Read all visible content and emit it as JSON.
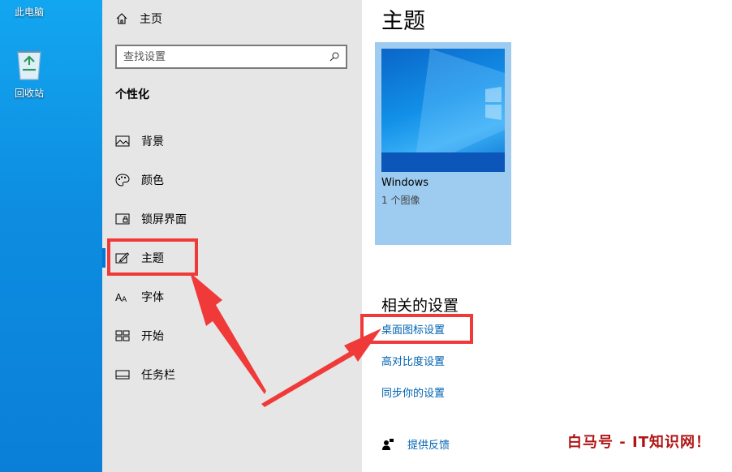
{
  "desktop": {
    "this_pc_label": "此电脑",
    "recycle_bin_label": "回收站"
  },
  "nav": {
    "home_label": "主页",
    "search_placeholder": "查找设置",
    "section_title": "个性化",
    "items": [
      {
        "label": "背景",
        "icon": "image-icon"
      },
      {
        "label": "颜色",
        "icon": "palette-icon"
      },
      {
        "label": "锁屏界面",
        "icon": "lock-screen-icon"
      },
      {
        "label": "主题",
        "icon": "theme-brush-icon",
        "active": true
      },
      {
        "label": "字体",
        "icon": "font-icon"
      },
      {
        "label": "开始",
        "icon": "start-menu-icon"
      },
      {
        "label": "任务栏",
        "icon": "taskbar-icon"
      }
    ]
  },
  "main": {
    "title": "主题",
    "theme_card": {
      "name": "Windows",
      "count": "1 个图像"
    },
    "related_title": "相关的设置",
    "links": [
      "桌面图标设置",
      "高对比度设置",
      "同步你的设置"
    ],
    "feedback_label": "提供反馈"
  },
  "watermark": "白马号 - IT知识网！",
  "colors": {
    "accent": "#0078d7",
    "link": "#0063b1",
    "annotation": "#f03a3a"
  }
}
